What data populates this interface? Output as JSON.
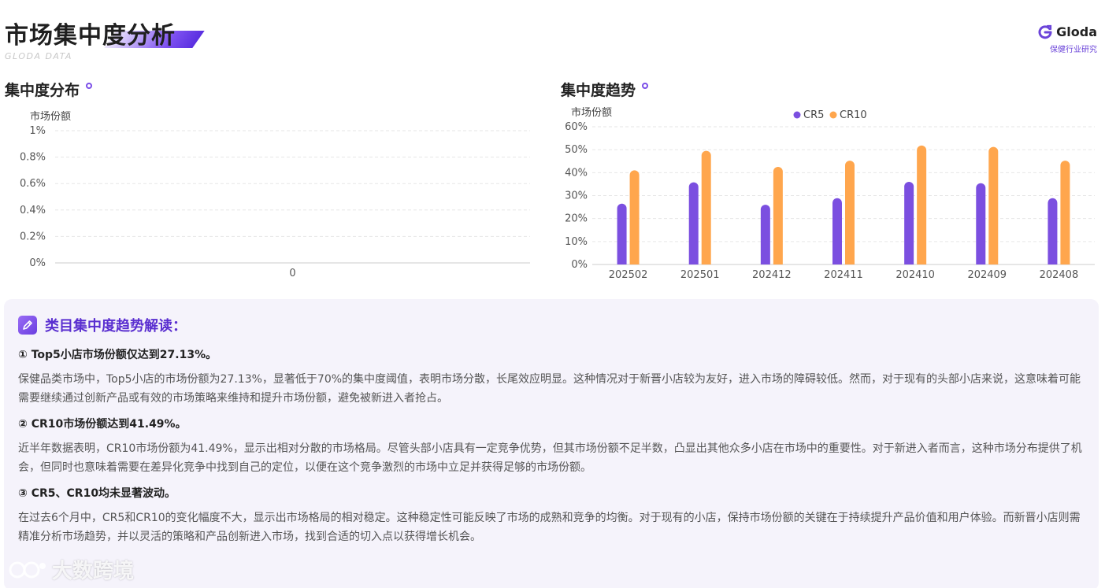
{
  "header": {
    "title": "市场集中度分析",
    "subtitle": "GLODA DATA",
    "brand_name": "Gloda",
    "brand_tag": "保健行业研究"
  },
  "colors": {
    "cr5": "#7b4fe0",
    "cr10": "#ffa64d",
    "accent": "#5a2fd0"
  },
  "sections": {
    "distribution": "集中度分布",
    "trend": "集中度趋势"
  },
  "chart_data": [
    {
      "type": "bar",
      "title": "集中度分布",
      "ylabel": "市场份额",
      "categories": [
        "0"
      ],
      "series": [],
      "ylim": [
        0,
        1
      ],
      "y_ticks": [
        "0%",
        "0.2%",
        "0.4%",
        "0.6%",
        "0.8%",
        "1%"
      ],
      "grid": true
    },
    {
      "type": "bar",
      "title": "集中度趋势",
      "ylabel": "市场份额",
      "categories": [
        "202502",
        "202501",
        "202412",
        "202411",
        "202410",
        "202409",
        "202408"
      ],
      "series": [
        {
          "name": "CR5",
          "values": [
            26.5,
            35.8,
            26.0,
            28.9,
            36.0,
            35.4,
            28.9
          ]
        },
        {
          "name": "CR10",
          "values": [
            41.0,
            49.5,
            42.5,
            45.2,
            51.8,
            51.2,
            45.2
          ]
        }
      ],
      "ylim": [
        0,
        60
      ],
      "y_ticks": [
        "0%",
        "10%",
        "20%",
        "30%",
        "40%",
        "50%",
        "60%"
      ],
      "legend": "top",
      "grid": true
    }
  ],
  "analysis": {
    "title": "类目集中度趋势解读：",
    "items": [
      {
        "title": "① Top5小店市场份额仅达到27.13%。",
        "body": "保健品类市场中，Top5小店的市场份额为27.13%，显著低于70%的集中度阈值，表明市场分散，长尾效应明显。这种情况对于新晋小店较为友好，进入市场的障碍较低。然而，对于现有的头部小店来说，这意味着可能需要继续通过创新产品或有效的市场策略来维持和提升市场份额，避免被新进入者抢占。"
      },
      {
        "title": "② CR10市场份额达到41.49%。",
        "body": "近半年数据表明，CR10市场份额为41.49%，显示出相对分散的市场格局。尽管头部小店具有一定竞争优势，但其市场份额不足半数，凸显出其他众多小店在市场中的重要性。对于新进入者而言，这种市场分布提供了机会，但同时也意味着需要在差异化竞争中找到自己的定位，以便在这个竞争激烈的市场中立足并获得足够的市场份额。"
      },
      {
        "title": "③ CR5、CR10均未显著波动。",
        "body": "在过去6个月中，CR5和CR10的变化幅度不大，显示出市场格局的相对稳定。这种稳定性可能反映了市场的成熟和竞争的均衡。对于现有的小店，保持市场份额的关键在于持续提升产品价值和用户体验。而新晋小店则需精准分析市场趋势，并以灵活的策略和产品创新进入市场，找到合适的切入点以获得增长机会。"
      }
    ]
  },
  "watermark": "大数跨境"
}
